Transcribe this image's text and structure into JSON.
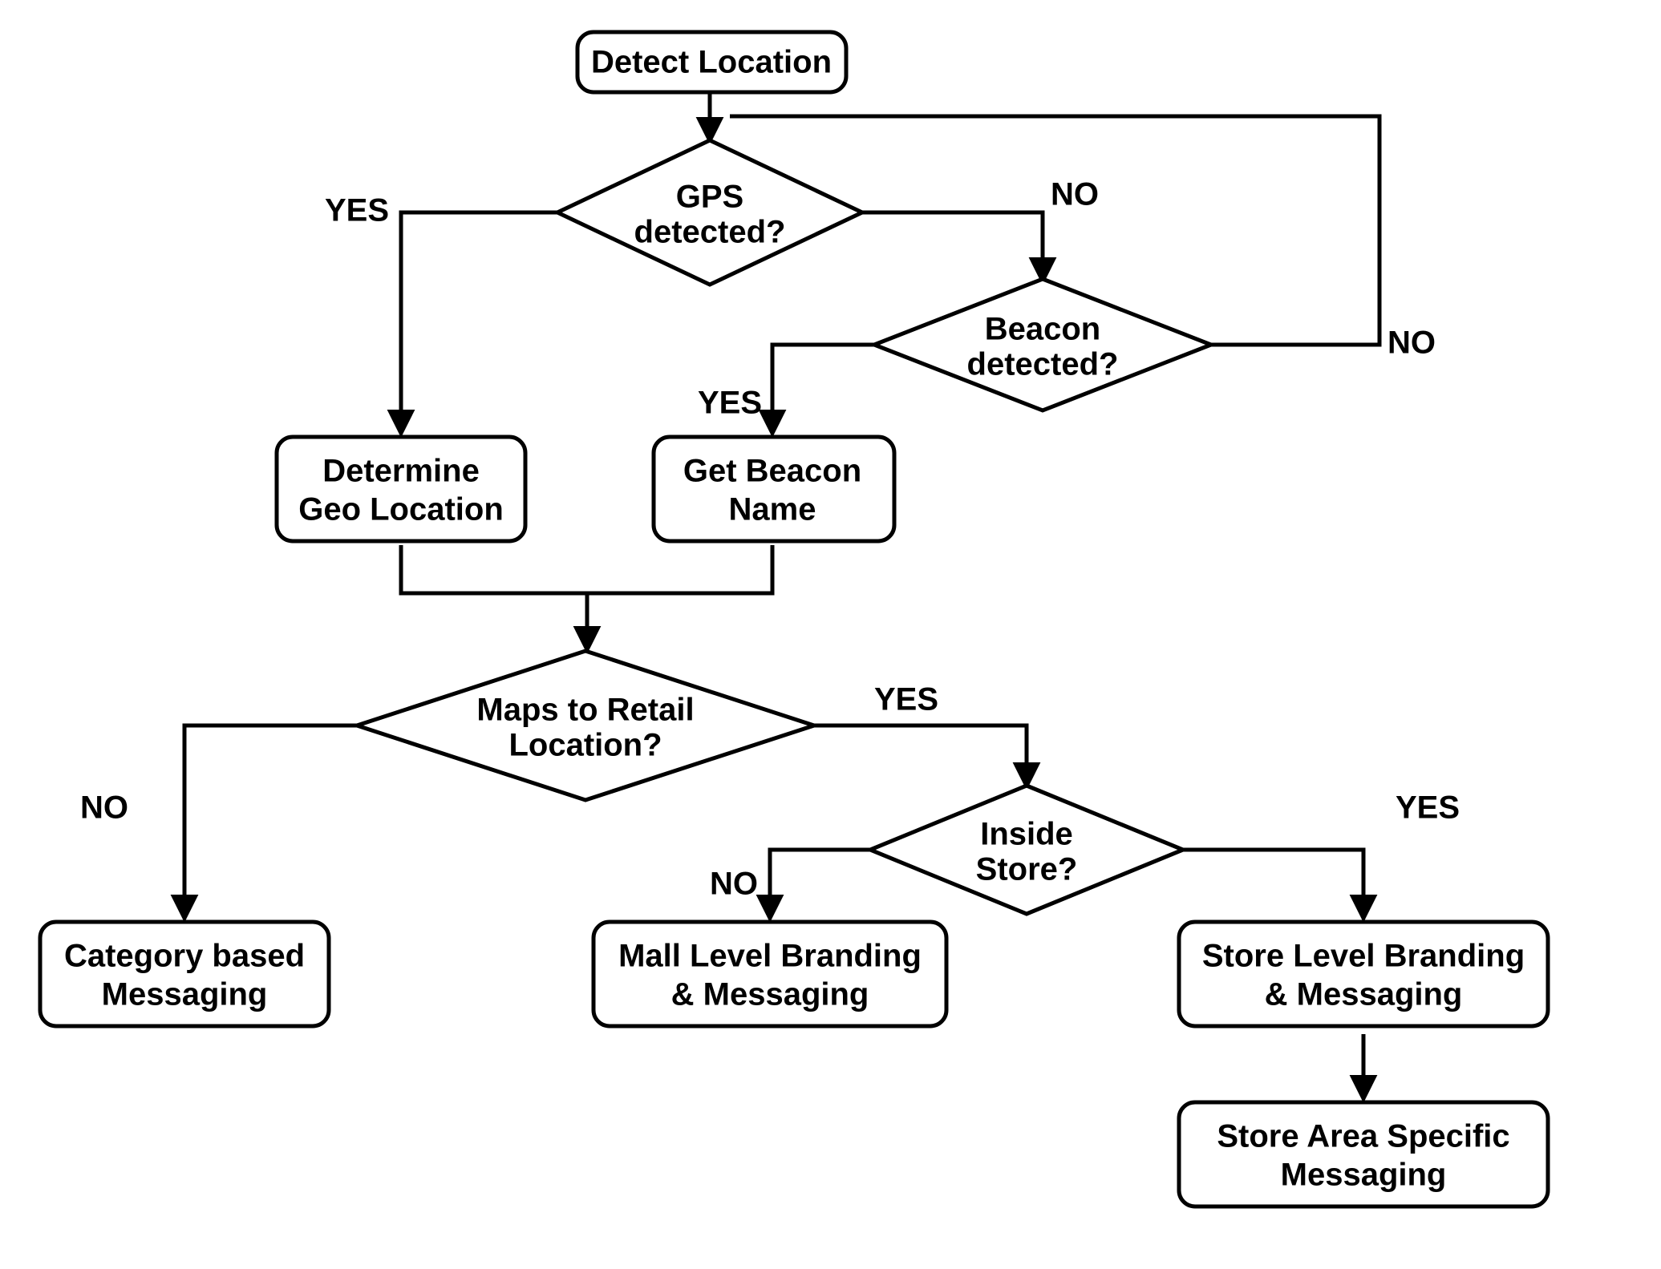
{
  "nodes": {
    "detect_location": "Detect Location",
    "gps_detected_l1": "GPS",
    "gps_detected_l2": "detected?",
    "beacon_detected_l1": "Beacon",
    "beacon_detected_l2": "detected?",
    "determine_geo_l1": "Determine",
    "determine_geo_l2": "Geo Location",
    "get_beacon_l1": "Get Beacon",
    "get_beacon_l2": "Name",
    "maps_retail_l1": "Maps to Retail",
    "maps_retail_l2": "Location?",
    "inside_store_l1": "Inside",
    "inside_store_l2": "Store?",
    "category_msg_l1": "Category based",
    "category_msg_l2": "Messaging",
    "mall_branding_l1": "Mall Level Branding",
    "mall_branding_l2": "& Messaging",
    "store_branding_l1": "Store Level Branding",
    "store_branding_l2": "& Messaging",
    "store_area_l1": "Store Area Specific",
    "store_area_l2": "Messaging"
  },
  "labels": {
    "yes": "YES",
    "no": "NO"
  }
}
